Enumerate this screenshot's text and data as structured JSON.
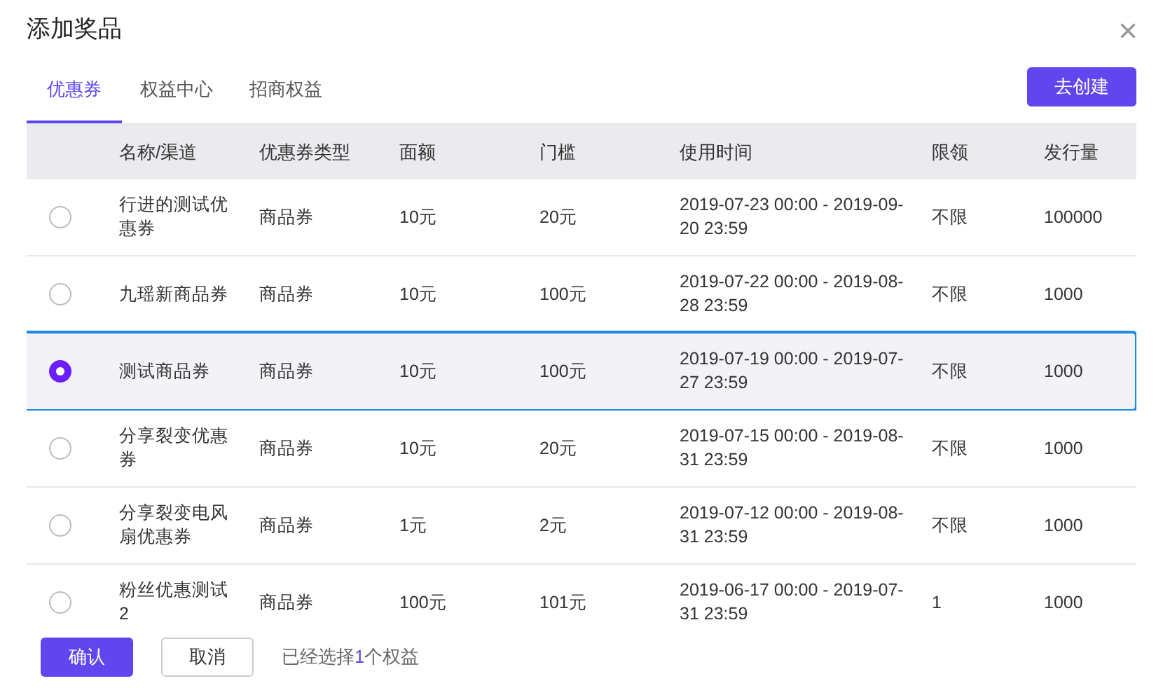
{
  "dialog": {
    "title": "添加奖品",
    "close": "×"
  },
  "tabs": [
    {
      "label": "优惠券",
      "selected": true
    },
    {
      "label": "权益中心",
      "selected": false
    },
    {
      "label": "招商权益",
      "selected": false
    }
  ],
  "create_button": "去创建",
  "table": {
    "columns": [
      "名称/渠道",
      "优惠券类型",
      "面额",
      "门槛",
      "使用时间",
      "限领",
      "发行量"
    ],
    "rows": [
      {
        "selected": false,
        "cells": [
          "行进的测试优惠券",
          "商品券",
          "10元",
          "20元",
          "2019-07-23 00:00 - 2019-09-20 23:59",
          "不限",
          "100000"
        ]
      },
      {
        "selected": false,
        "cells": [
          "九瑶新商品券",
          "商品券",
          "10元",
          "100元",
          "2019-07-22 00:00 - 2019-08-28 23:59",
          "不限",
          "1000"
        ]
      },
      {
        "selected": true,
        "cells": [
          "测试商品券",
          "商品券",
          "10元",
          "100元",
          "2019-07-19 00:00 - 2019-07-27 23:59",
          "不限",
          "1000"
        ]
      },
      {
        "selected": false,
        "cells": [
          "分享裂变优惠券",
          "商品券",
          "10元",
          "20元",
          "2019-07-15 00:00 - 2019-08-31 23:59",
          "不限",
          "1000"
        ]
      },
      {
        "selected": false,
        "cells": [
          "分享裂变电风扇优惠券",
          "商品券",
          "1元",
          "2元",
          "2019-07-12 00:00 - 2019-08-31 23:59",
          "不限",
          "1000"
        ]
      },
      {
        "selected": false,
        "cells": [
          "粉丝优惠测试 2",
          "商品券",
          "100元",
          "101元",
          "2019-06-17 00:00 - 2019-07-31 23:59",
          "1",
          "1000"
        ]
      }
    ]
  },
  "footer": {
    "confirm": "确认",
    "cancel": "取消",
    "summary_before": "已经选择",
    "summary_count": "1",
    "summary_after": "个权益"
  }
}
